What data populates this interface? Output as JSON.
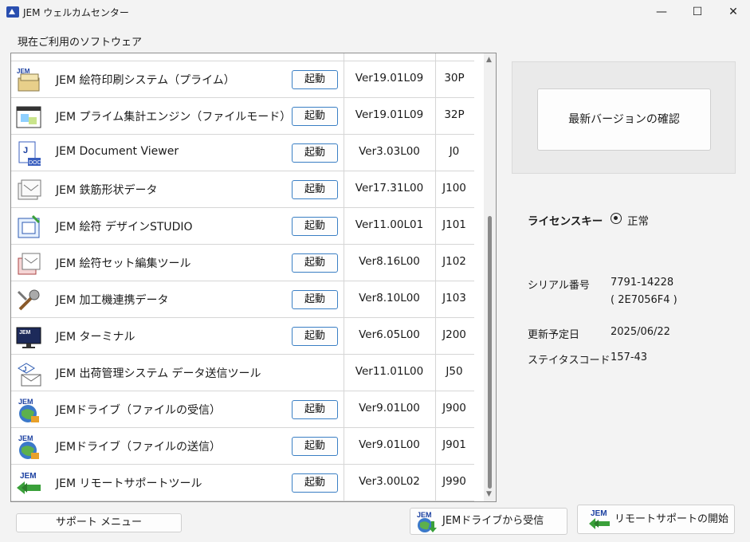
{
  "window": {
    "title": "JEM ウェルカムセンター",
    "minimize": "—",
    "maximize": "☐",
    "close": "✕"
  },
  "section_label": "現在ご利用のソフトウェア",
  "software": [
    {
      "name": "JEM 絵符印刷システム（プライム）",
      "launch": "起動",
      "version": "Ver19.01L09",
      "code": "30P",
      "icon": "print-icon"
    },
    {
      "name": "JEM プライム集計エンジン（ファイルモード）",
      "launch": "起動",
      "version": "Ver19.01L09",
      "code": "32P",
      "icon": "engine-icon"
    },
    {
      "name": "JEM Document Viewer",
      "launch": "起動",
      "version": "Ver3.03L00",
      "code": "J0",
      "icon": "document-icon"
    },
    {
      "name": "JEM 鉄筋形状データ",
      "launch": "起動",
      "version": "Ver17.31L00",
      "code": "J100",
      "icon": "rebar-data-icon"
    },
    {
      "name": "JEM 絵符 デザインSTUDIO",
      "launch": "起動",
      "version": "Ver11.00L01",
      "code": "J101",
      "icon": "design-studio-icon"
    },
    {
      "name": "JEM 絵符セット編集ツール",
      "launch": "起動",
      "version": "Ver8.16L00",
      "code": "J102",
      "icon": "set-edit-icon"
    },
    {
      "name": "JEM 加工機連携データ",
      "launch": "起動",
      "version": "Ver8.10L00",
      "code": "J103",
      "icon": "tools-icon"
    },
    {
      "name": "JEM ターミナル",
      "launch": "起動",
      "version": "Ver6.05L00",
      "code": "J200",
      "icon": "terminal-icon"
    },
    {
      "name": "JEM 出荷管理システム データ送信ツール",
      "launch": "",
      "version": "Ver11.01L00",
      "code": "J50",
      "icon": "mail-send-icon"
    },
    {
      "name": "JEMドライブ（ファイルの受信）",
      "launch": "起動",
      "version": "Ver9.01L00",
      "code": "J900",
      "icon": "globe-receive-icon"
    },
    {
      "name": "JEMドライブ（ファイルの送信）",
      "launch": "起動",
      "version": "Ver9.01L00",
      "code": "J901",
      "icon": "globe-send-icon"
    },
    {
      "name": "JEM リモートサポートツール",
      "launch": "起動",
      "version": "Ver3.00L02",
      "code": "J990",
      "icon": "remote-arrow-icon"
    }
  ],
  "right_panel": {
    "check_button": "最新バージョンの確認"
  },
  "license": {
    "label": "ライセンスキー",
    "status": "正常"
  },
  "info": {
    "serial_label": "シリアル番号",
    "serial_value": "7791-14228",
    "serial_sub": "( 2E7056F4 )",
    "renew_label": "更新予定日",
    "renew_value": "2025/06/22",
    "status_label": "ステイタスコード",
    "status_value": "157-43"
  },
  "buttons": {
    "support_menu": "サポート メニュー",
    "drive_receive": "JEMドライブから受信",
    "remote_start": "リモートサポートの開始"
  },
  "brand_text": "JEM",
  "colors": {
    "accent": "#3a7fc4",
    "jem_blue": "#1a3fa0",
    "green": "#3aa03a"
  }
}
